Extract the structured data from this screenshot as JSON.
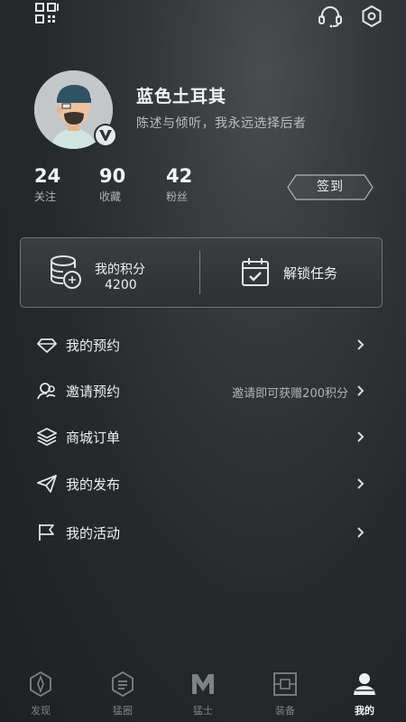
{
  "profile": {
    "username": "蓝色土耳其",
    "bio": "陈述与倾听，我永远选择后者",
    "verified_badge": "V"
  },
  "stats": [
    {
      "value": "24",
      "label": "关注"
    },
    {
      "value": "90",
      "label": "收藏"
    },
    {
      "value": "42",
      "label": "粉丝"
    }
  ],
  "checkin_label": "签到",
  "card": {
    "points_label": "我的积分",
    "points_value": "4200",
    "task_label": "解锁任务"
  },
  "menu": [
    {
      "label": "我的预约",
      "extra": "",
      "icon": "diamond-icon"
    },
    {
      "label": "邀请预约",
      "extra": "邀请即可获赠200积分",
      "icon": "invite-icon"
    },
    {
      "label": "商城订单",
      "extra": "",
      "icon": "layers-icon"
    },
    {
      "label": "我的发布",
      "extra": "",
      "icon": "paper-plane-icon"
    },
    {
      "label": "我的活动",
      "extra": "",
      "icon": "flag-icon"
    }
  ],
  "tabs": [
    {
      "label": "发现",
      "icon": "compass-icon"
    },
    {
      "label": "猛圈",
      "icon": "circle-hex-icon"
    },
    {
      "label": "猛士",
      "icon": "m-logo-icon"
    },
    {
      "label": "装备",
      "icon": "gear-box-icon"
    },
    {
      "label": "我的",
      "icon": "person-icon",
      "active": true
    }
  ],
  "colors": {
    "background": "#25292b",
    "text": "#eef1f1",
    "muted": "#aeb3b4",
    "border": "#6f7576"
  }
}
